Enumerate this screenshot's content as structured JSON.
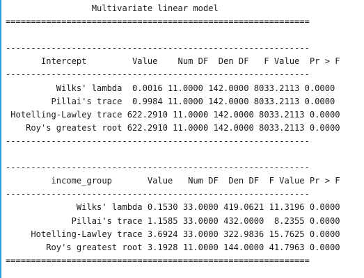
{
  "output": {
    "lines": [
      "                 Multivariate linear model",
      "============================================================",
      "",
      "------------------------------------------------------------",
      "       Intercept         Value    Num DF  Den DF   F Value  Pr > F",
      "------------------------------------------------------------",
      "          Wilks' lambda  0.0016 11.0000 142.0000 8033.2113 0.0000",
      "         Pillai's trace  0.9984 11.0000 142.0000 8033.2113 0.0000",
      " Hotelling-Lawley trace 622.2910 11.0000 142.0000 8033.2113 0.0000",
      "    Roy's greatest root 622.2910 11.0000 142.0000 8033.2113 0.0000",
      "------------------------------------------------------------",
      "",
      "------------------------------------------------------------",
      "         income_group       Value   Num DF  Den DF  F Value Pr > F",
      "------------------------------------------------------------",
      "              Wilks' lambda 0.1530 33.0000 419.0621 11.3196 0.0000",
      "             Pillai's trace 1.1585 33.0000 432.0000  8.2355 0.0000",
      "     Hotelling-Lawley trace 3.6924 33.0000 322.9836 15.7625 0.0000",
      "        Roy's greatest root 3.1928 11.0000 144.0000 41.7963 0.0000",
      "============================================================"
    ]
  }
}
